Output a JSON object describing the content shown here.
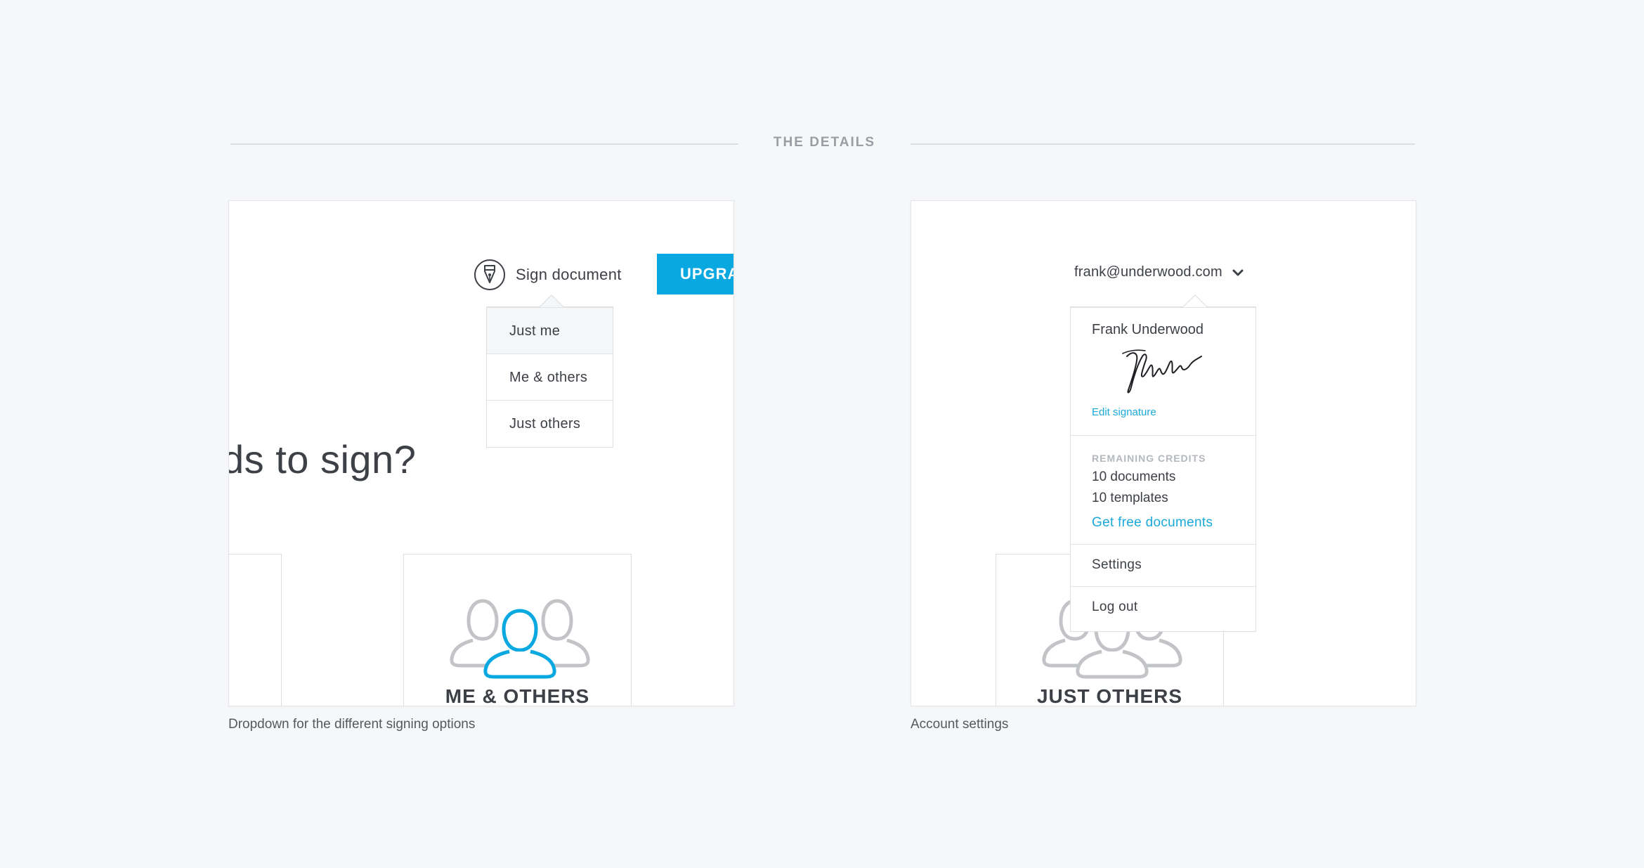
{
  "section": {
    "title": "THE DETAILS"
  },
  "left_panel": {
    "caption": "Dropdown for the different signing options",
    "sign_document_label": "Sign document",
    "upgrade_label": "UPGRADE",
    "headline": "ds to sign?",
    "dropdown_items": [
      "Just me",
      "Me & others",
      "Just others"
    ],
    "card_label": "ME & OTHERS"
  },
  "right_panel": {
    "caption": "Account settings",
    "email": "frank@underwood.com",
    "user_name": "Frank Underwood",
    "edit_signature": "Edit signature",
    "credits_title": "REMAINING CREDITS",
    "credits_documents": "10 documents",
    "credits_templates": "10 templates",
    "get_free": "Get free documents",
    "settings": "Settings",
    "logout": "Log out",
    "card_label": "JUST OTHERS"
  },
  "colors": {
    "accent": "#0aa8e0",
    "link": "#1aa9d9",
    "text": "#3d4046",
    "muted": "#9a9da3",
    "icon_gray": "#c2c4c7"
  },
  "icons": {
    "pen": "pen-nib-icon",
    "chevron": "chevron-down-icon",
    "people": "people-group-icon",
    "signature": "handwritten-signature"
  }
}
